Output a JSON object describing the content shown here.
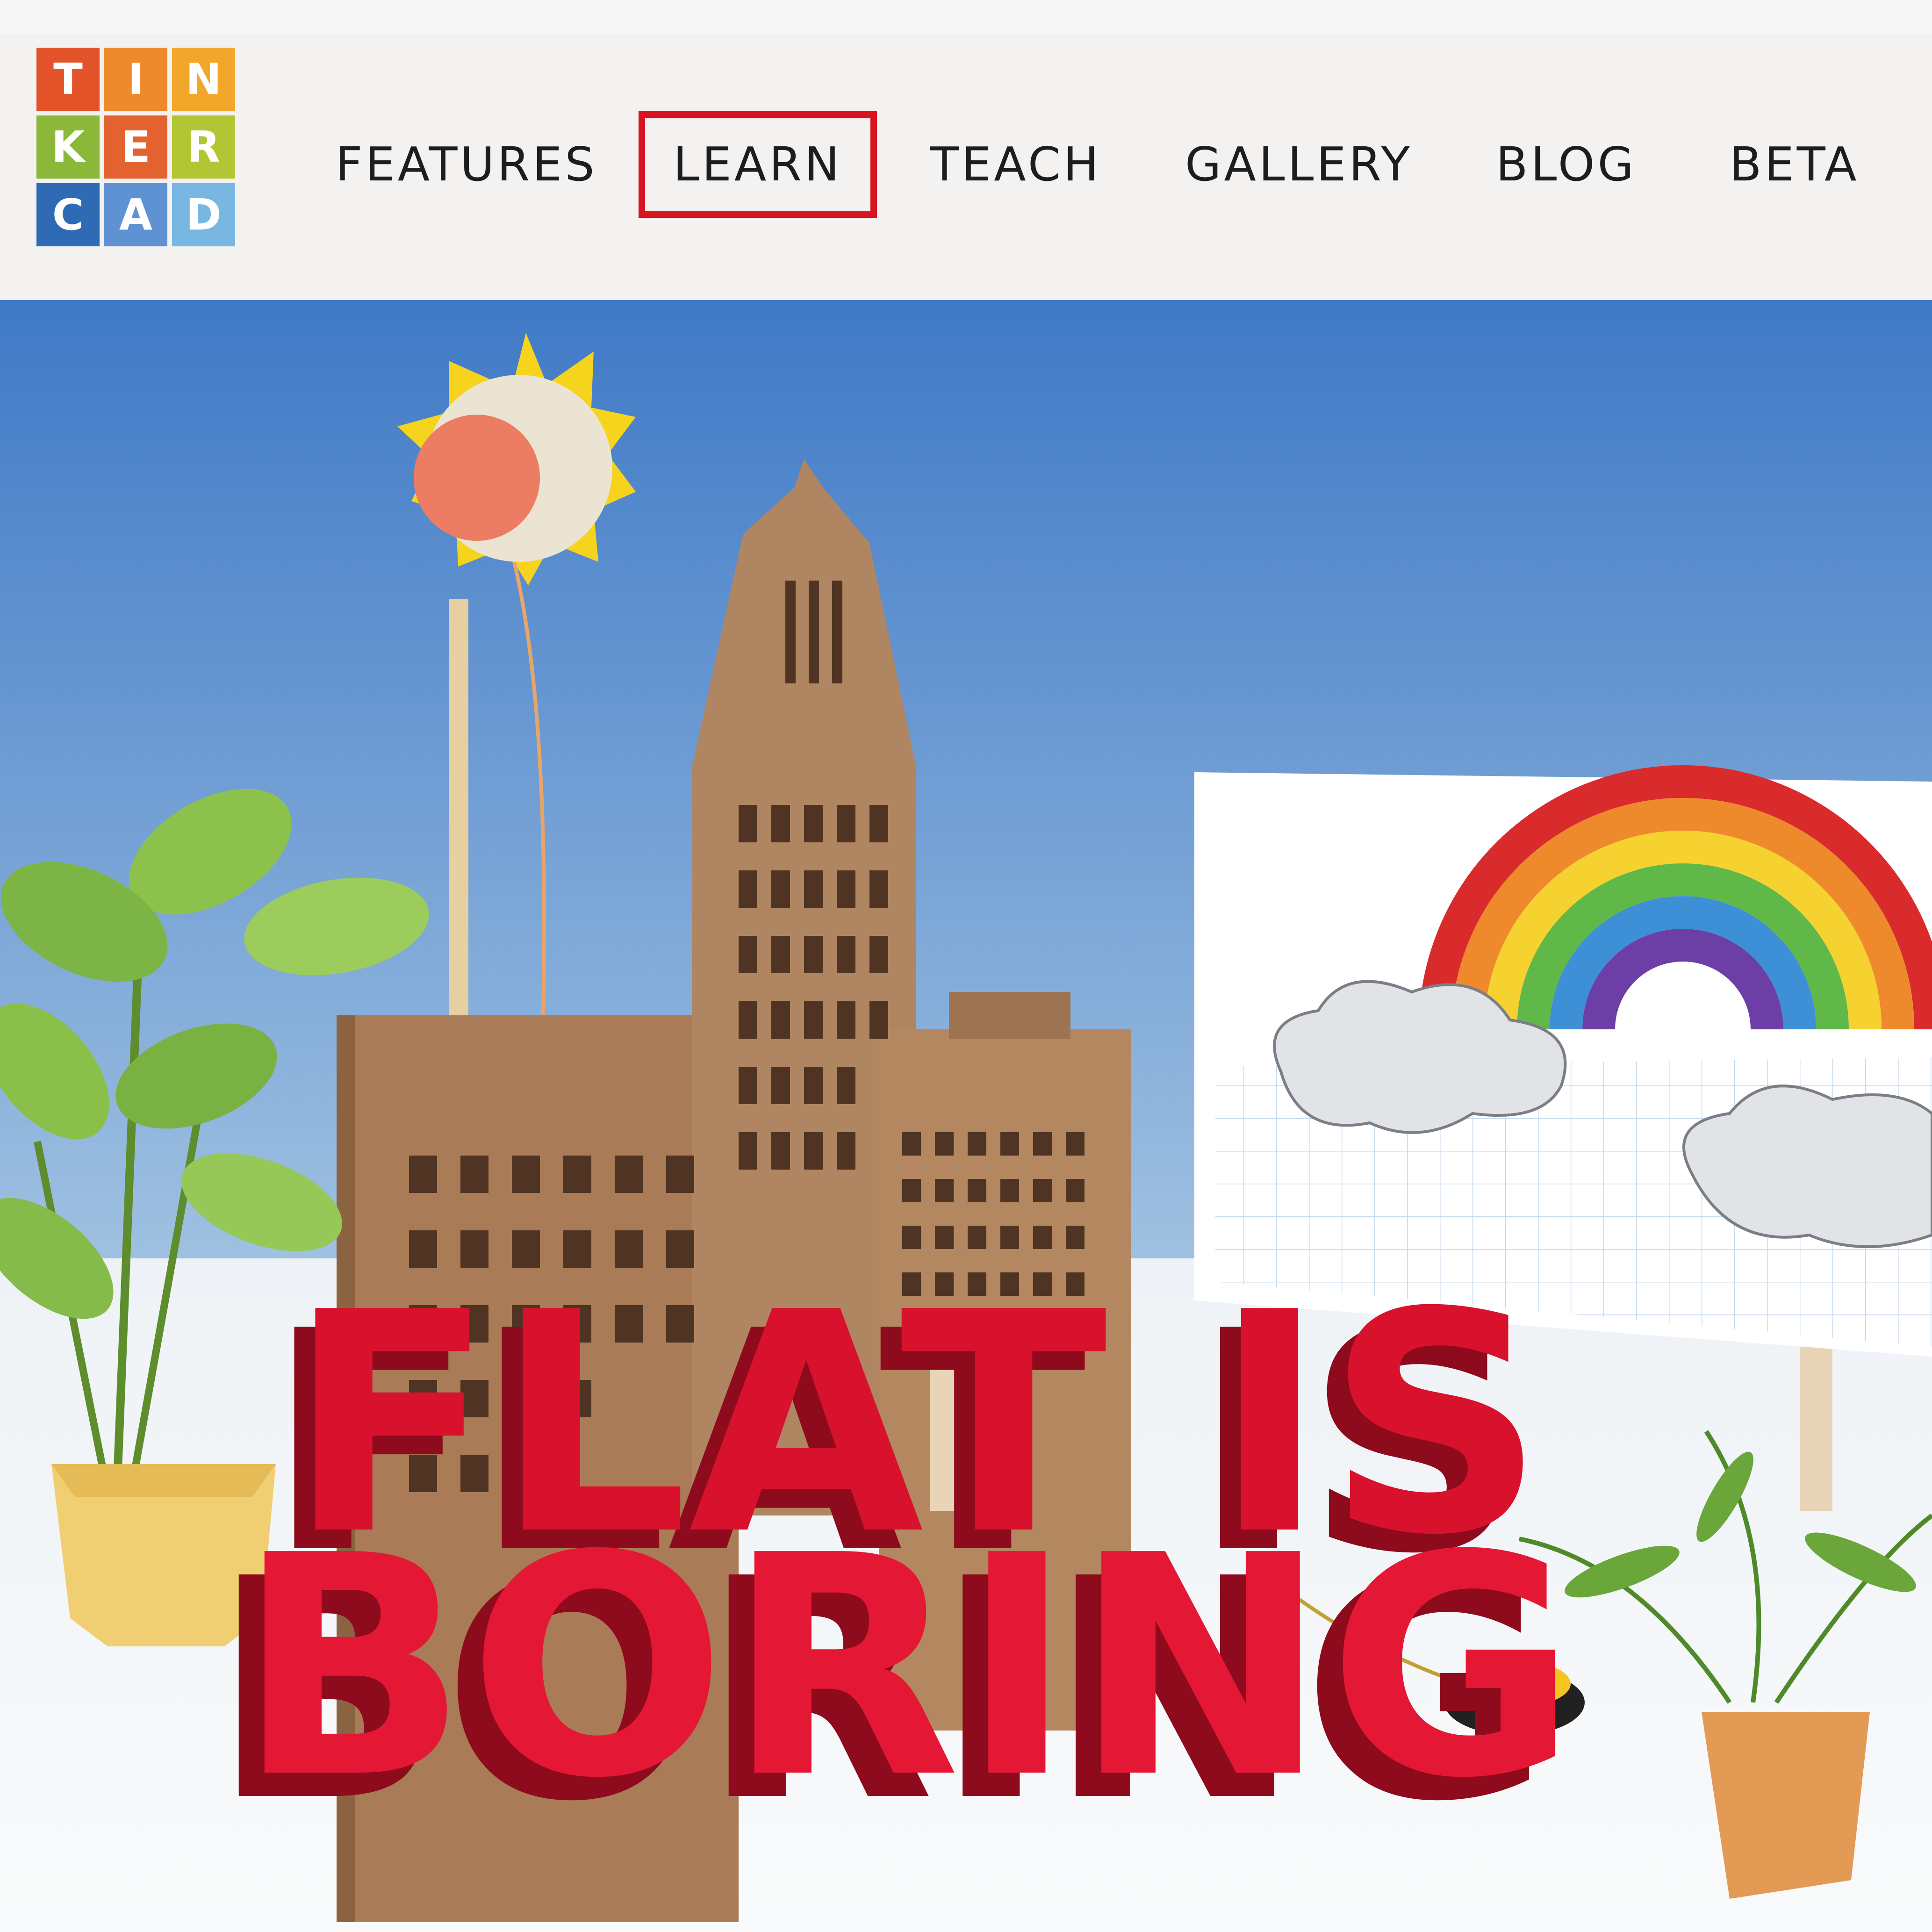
{
  "brand": {
    "logo_letters": [
      "T",
      "I",
      "N",
      "K",
      "E",
      "R",
      "C",
      "A",
      "D"
    ],
    "logo_colors": [
      "#e2532a",
      "#ef8a2c",
      "#f3a72a",
      "#8cb83a",
      "#e3622f",
      "#b2c634",
      "#2f6bb5",
      "#5f92d3",
      "#78b7e2"
    ]
  },
  "nav": {
    "items": [
      {
        "label": "FEATURES"
      },
      {
        "label": "LEARN",
        "highlighted": true
      },
      {
        "label": "TEACH"
      },
      {
        "label": "GALLERY"
      },
      {
        "label": "BLOG"
      },
      {
        "label": "BETA"
      }
    ]
  },
  "hero": {
    "slogan_line1": "FLAT IS",
    "slogan_line2": "BORING"
  },
  "colors": {
    "sky_top": "#3f79c6",
    "sky_bottom": "#9fc1e0",
    "accent_red": "#d8122d",
    "highlight_box": "#d7141f",
    "cardboard": "#a77c59"
  }
}
